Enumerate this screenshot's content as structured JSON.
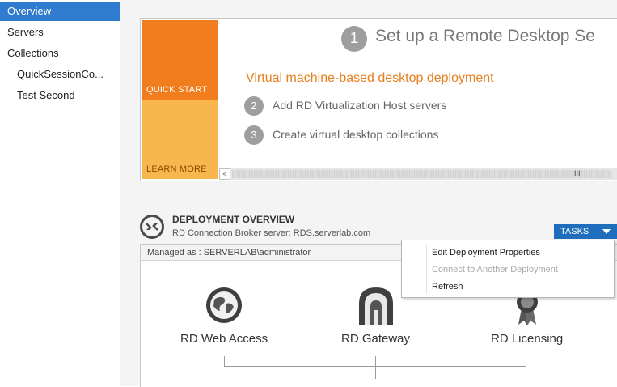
{
  "sidebar": {
    "items": [
      {
        "label": "Overview",
        "active": true
      },
      {
        "label": "Servers"
      },
      {
        "label": "Collections"
      },
      {
        "label": "QuickSessionCo..."
      },
      {
        "label": "Test Second"
      }
    ]
  },
  "quickstart": {
    "tile_quick_start": "QUICK START",
    "tile_learn_more": "LEARN MORE",
    "step1_number": "1",
    "title": "Set up a Remote Desktop Se",
    "subtitle": "Virtual machine-based desktop deployment",
    "step2_number": "2",
    "step2_text": "Add RD Virtualization Host servers",
    "step3_number": "3",
    "step3_text": "Create virtual desktop collections",
    "scroll_left": "<",
    "scroll_grip": "III"
  },
  "deployment": {
    "title": "DEPLOYMENT OVERVIEW",
    "subtitle": "RD Connection Broker server: RDS.serverlab.com",
    "tasks_label": "TASKS",
    "managed_as": "Managed as : SERVERLAB\\administrator",
    "roles": [
      {
        "label": "RD Web Access",
        "icon": "globe-icon"
      },
      {
        "label": "RD Gateway",
        "icon": "gateway-icon"
      },
      {
        "label": "RD Licensing",
        "icon": "license-badge-icon"
      }
    ]
  },
  "tasks_menu": {
    "items": [
      {
        "label": "Edit Deployment Properties",
        "enabled": true
      },
      {
        "label": "Connect to Another Deployment",
        "enabled": false
      },
      {
        "label": "Refresh",
        "enabled": true
      }
    ]
  },
  "colors": {
    "accent_blue": "#2e7bcf",
    "tasks_blue": "#1f6ebd",
    "orange": "#f07d1e",
    "yellow": "#f9b64c"
  }
}
